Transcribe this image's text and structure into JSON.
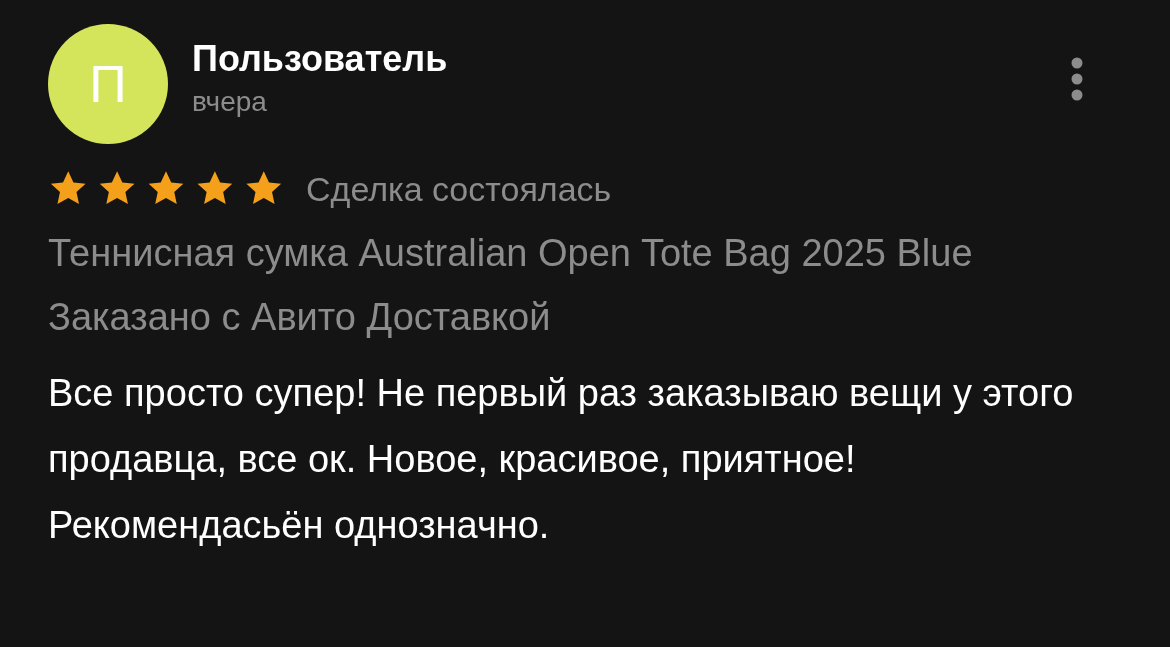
{
  "review": {
    "avatar_letter": "П",
    "author": "Пользователь",
    "date": "вчера",
    "stars": 5,
    "status": "Сделка состоялась",
    "product": "Теннисная сумка Australian Open Tote Bag 2025 Blue",
    "delivery": "Заказано с Авито Доставкой",
    "text": "Все просто супер! Не первый раз заказываю вещи у этого продавца, все ок. Новое, красивое, приятное! Рекомендасьён однозначно."
  }
}
